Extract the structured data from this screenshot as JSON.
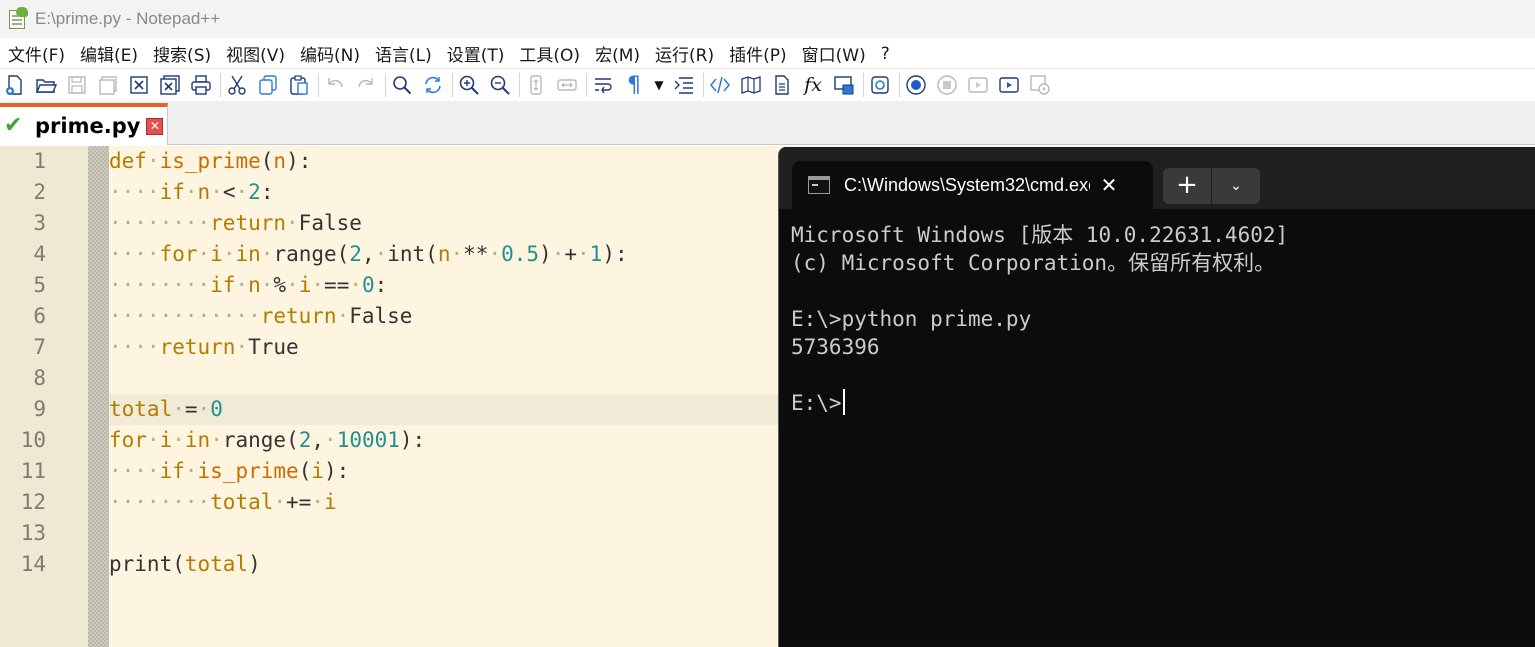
{
  "notepad": {
    "window_title": "E:\\prime.py - Notepad++",
    "menu": [
      "文件(F)",
      "编辑(E)",
      "搜索(S)",
      "视图(V)",
      "编码(N)",
      "语言(L)",
      "设置(T)",
      "工具(O)",
      "宏(M)",
      "运行(R)",
      "插件(P)",
      "窗口(W)",
      "?"
    ],
    "toolbar_icons": [
      "new-file-icon",
      "open-file-icon",
      "save-icon",
      "save-all-icon",
      "close-icon",
      "close-all-icon",
      "print-icon",
      "cut-icon",
      "copy-icon",
      "paste-icon",
      "undo-icon",
      "redo-icon",
      "find-icon",
      "replace-icon",
      "zoom-in-icon",
      "zoom-out-icon",
      "sync-vertical-icon",
      "sync-horizontal-icon",
      "word-wrap-icon",
      "show-all-characters-icon",
      "indent-guide-icon",
      "folder-as-workspace-icon",
      "document-map-icon",
      "function-list-icon",
      "xml-tag-icon",
      "monitoring-icon",
      "start-recording-icon",
      "stop-recording-icon",
      "playback-icon",
      "run-macro-multiple-icon",
      "save-macro-icon"
    ],
    "tab": {
      "label": "prime.py",
      "status_icon": "saved-check-icon",
      "close_icon": "tab-close-icon"
    },
    "editor": {
      "line_numbers": [
        "1",
        "2",
        "3",
        "4",
        "5",
        "6",
        "7",
        "8",
        "9",
        "10",
        "11",
        "12",
        "13",
        "14"
      ],
      "current_line": "9",
      "lines": [
        "def·is_prime(n):",
        "····if·n·<·2:",
        "········return·False",
        "····for·i·in·range(2,·int(n·**·0.5)·+·1):",
        "········if·n·%·i·==·0:",
        "············return·False",
        "····return·True",
        "",
        "total·=·0",
        "for·i·in·range(2,·10001):",
        "····if·is_prime(i):",
        "········total·+=·i",
        "",
        "print(total)"
      ]
    },
    "colors": {
      "keyword": "#b37b00",
      "function": "#cc6c00",
      "number": "#229090",
      "whitespace_dot": "#b7ad89",
      "background": "#fdf5e0",
      "tab_accent": "#e2622a"
    }
  },
  "terminal": {
    "tab_title": "C:\\Windows\\System32\\cmd.exe",
    "new_tab_label": "+",
    "dropdown_icon": "chevron-down-icon",
    "lines": [
      "Microsoft Windows [版本 10.0.22631.4602]",
      "(c) Microsoft Corporation。保留所有权利。",
      "",
      "E:\\>python prime.py",
      "5736396",
      "",
      "E:\\>"
    ]
  }
}
